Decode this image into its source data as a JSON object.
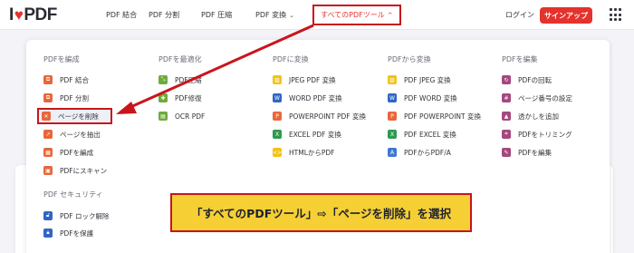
{
  "logo": {
    "text_left": "I",
    "text_right": "PDF"
  },
  "nav": {
    "items": [
      {
        "label": "PDF 結合"
      },
      {
        "label": "PDF 分割"
      },
      {
        "label": "PDF 圧縮"
      },
      {
        "label": "PDF 変換"
      },
      {
        "label": "すべてのPDFツール"
      }
    ],
    "login": "ログイン",
    "signup": "サインアップ"
  },
  "columns": [
    {
      "title": "PDFを編成",
      "items": [
        "PDF 結合",
        "PDF 分割",
        "ページを削除",
        "ページを抽出",
        "PDFを編成",
        "PDFにスキャン"
      ]
    },
    {
      "title": "PDFを最適化",
      "items": [
        "PDF圧縮",
        "PDF修復",
        "OCR PDF"
      ]
    },
    {
      "title": "PDFに変換",
      "items": [
        "JPEG PDF 変換",
        "WORD PDF 変換",
        "POWERPOINT PDF 変換",
        "EXCEL PDF 変換",
        "HTMLからPDF"
      ]
    },
    {
      "title": "PDFから変換",
      "items": [
        "PDF JPEG 変換",
        "PDF WORD 変換",
        "PDF POWERPOINT 変換",
        "PDF EXCEL 変換",
        "PDFからPDF/A"
      ]
    },
    {
      "title": "PDFを編集",
      "items": [
        "PDFの回転",
        "ページ番号の設定",
        "透かしを追加",
        "PDFをトリミング",
        "PDFを編集"
      ]
    }
  ],
  "security": {
    "title": "PDF セキュリティ",
    "items": [
      "PDF ロック解除",
      "PDFを保護"
    ]
  },
  "caption": "「すべてのPDFツール」⇨「ページを削除」を選択",
  "colors": {
    "accent": "#e5322d",
    "highlight": "#c8151c",
    "caption_bg": "#f6cf34"
  },
  "icons": {
    "merge": "merge-icon",
    "split": "split-icon",
    "delete": "close-icon",
    "extract": "extract-icon",
    "organize": "organize-icon",
    "scan": "scan-icon",
    "compress": "compress-icon",
    "repair": "repair-icon",
    "ocr": "ocr-icon",
    "jpg": "image-icon",
    "word": "word-icon",
    "ppt": "powerpoint-icon",
    "excel": "excel-icon",
    "html": "html-icon",
    "rotate": "rotate-icon",
    "number": "page-number-icon",
    "watermark": "watermark-icon",
    "crop": "crop-icon",
    "edit": "edit-icon",
    "unlock": "unlock-icon",
    "protect": "protect-icon"
  }
}
